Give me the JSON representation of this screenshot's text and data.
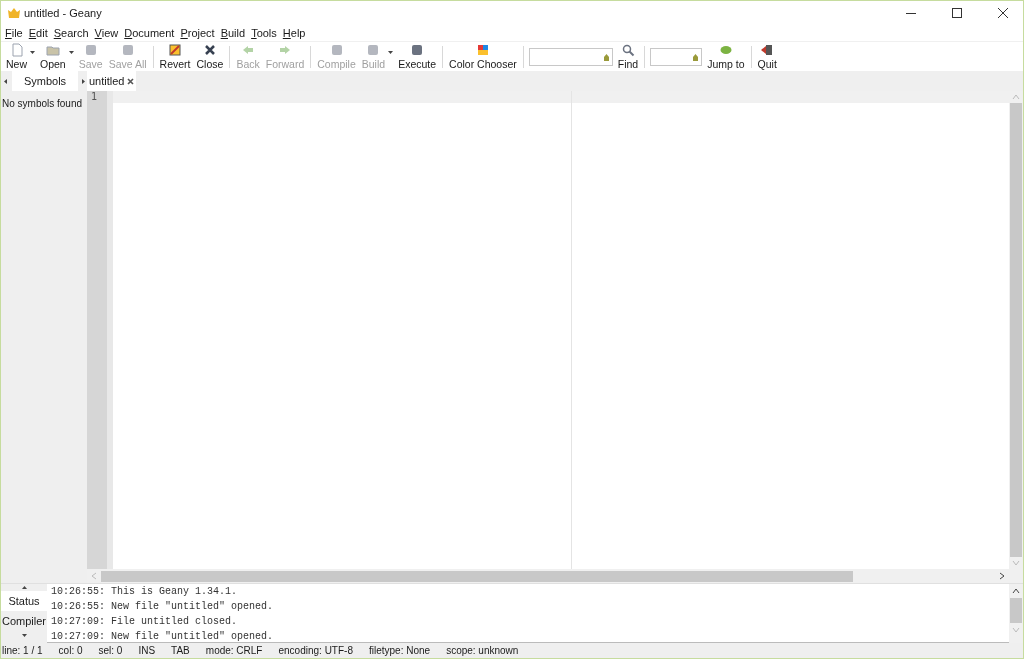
{
  "window": {
    "title": "untitled - Geany"
  },
  "menu": [
    "File",
    "Edit",
    "Search",
    "View",
    "Document",
    "Project",
    "Build",
    "Tools",
    "Help"
  ],
  "toolbar": [
    {
      "kind": "button",
      "label": "New",
      "disabled": false,
      "dropdown": true
    },
    {
      "kind": "button",
      "label": "Open",
      "disabled": false,
      "dropdown": true
    },
    {
      "kind": "button",
      "label": "Save",
      "disabled": true,
      "dropdown": false
    },
    {
      "kind": "button",
      "label": "Save All",
      "disabled": true,
      "dropdown": false
    },
    {
      "kind": "separator"
    },
    {
      "kind": "button",
      "label": "Revert",
      "disabled": false,
      "dropdown": false
    },
    {
      "kind": "button",
      "label": "Close",
      "disabled": false,
      "dropdown": false
    },
    {
      "kind": "separator"
    },
    {
      "kind": "button",
      "label": "Back",
      "disabled": true,
      "dropdown": false
    },
    {
      "kind": "button",
      "label": "Forward",
      "disabled": true,
      "dropdown": false
    },
    {
      "kind": "separator"
    },
    {
      "kind": "button",
      "label": "Compile",
      "disabled": true,
      "dropdown": false
    },
    {
      "kind": "button",
      "label": "Build",
      "disabled": true,
      "dropdown": true
    },
    {
      "kind": "button",
      "label": "Execute",
      "disabled": false,
      "dropdown": false
    },
    {
      "kind": "separator"
    },
    {
      "kind": "button",
      "label": "Color Chooser",
      "disabled": false,
      "dropdown": false
    },
    {
      "kind": "separator"
    },
    {
      "kind": "field"
    },
    {
      "kind": "button",
      "label": "Find",
      "disabled": false,
      "dropdown": false
    },
    {
      "kind": "separator"
    },
    {
      "kind": "field"
    },
    {
      "kind": "button",
      "label": "Jump to",
      "disabled": false,
      "dropdown": false
    },
    {
      "kind": "separator"
    },
    {
      "kind": "button",
      "label": "Quit",
      "disabled": false,
      "dropdown": false
    }
  ],
  "sidebar": {
    "tab": "Symbols",
    "message": "No symbols found"
  },
  "document_tabs": [
    {
      "label": "untitled",
      "selected": true
    }
  ],
  "editor": {
    "line_numbers": [
      "1"
    ]
  },
  "message_tabs": [
    {
      "label": "Status",
      "selected": true
    },
    {
      "label": "Compiler",
      "selected": false
    }
  ],
  "messages": [
    "10:26:55: This is Geany 1.34.1.",
    "10:26:55: New file \"untitled\" opened.",
    "10:27:09: File untitled closed.",
    "10:27:09: New file \"untitled\" opened."
  ],
  "status_bar": [
    "line: 1 / 1",
    "col: 0",
    "sel: 0",
    "INS",
    "TAB",
    "mode: CRLF",
    "encoding: UTF-8",
    "filetype: None",
    "scope: unknown"
  ]
}
